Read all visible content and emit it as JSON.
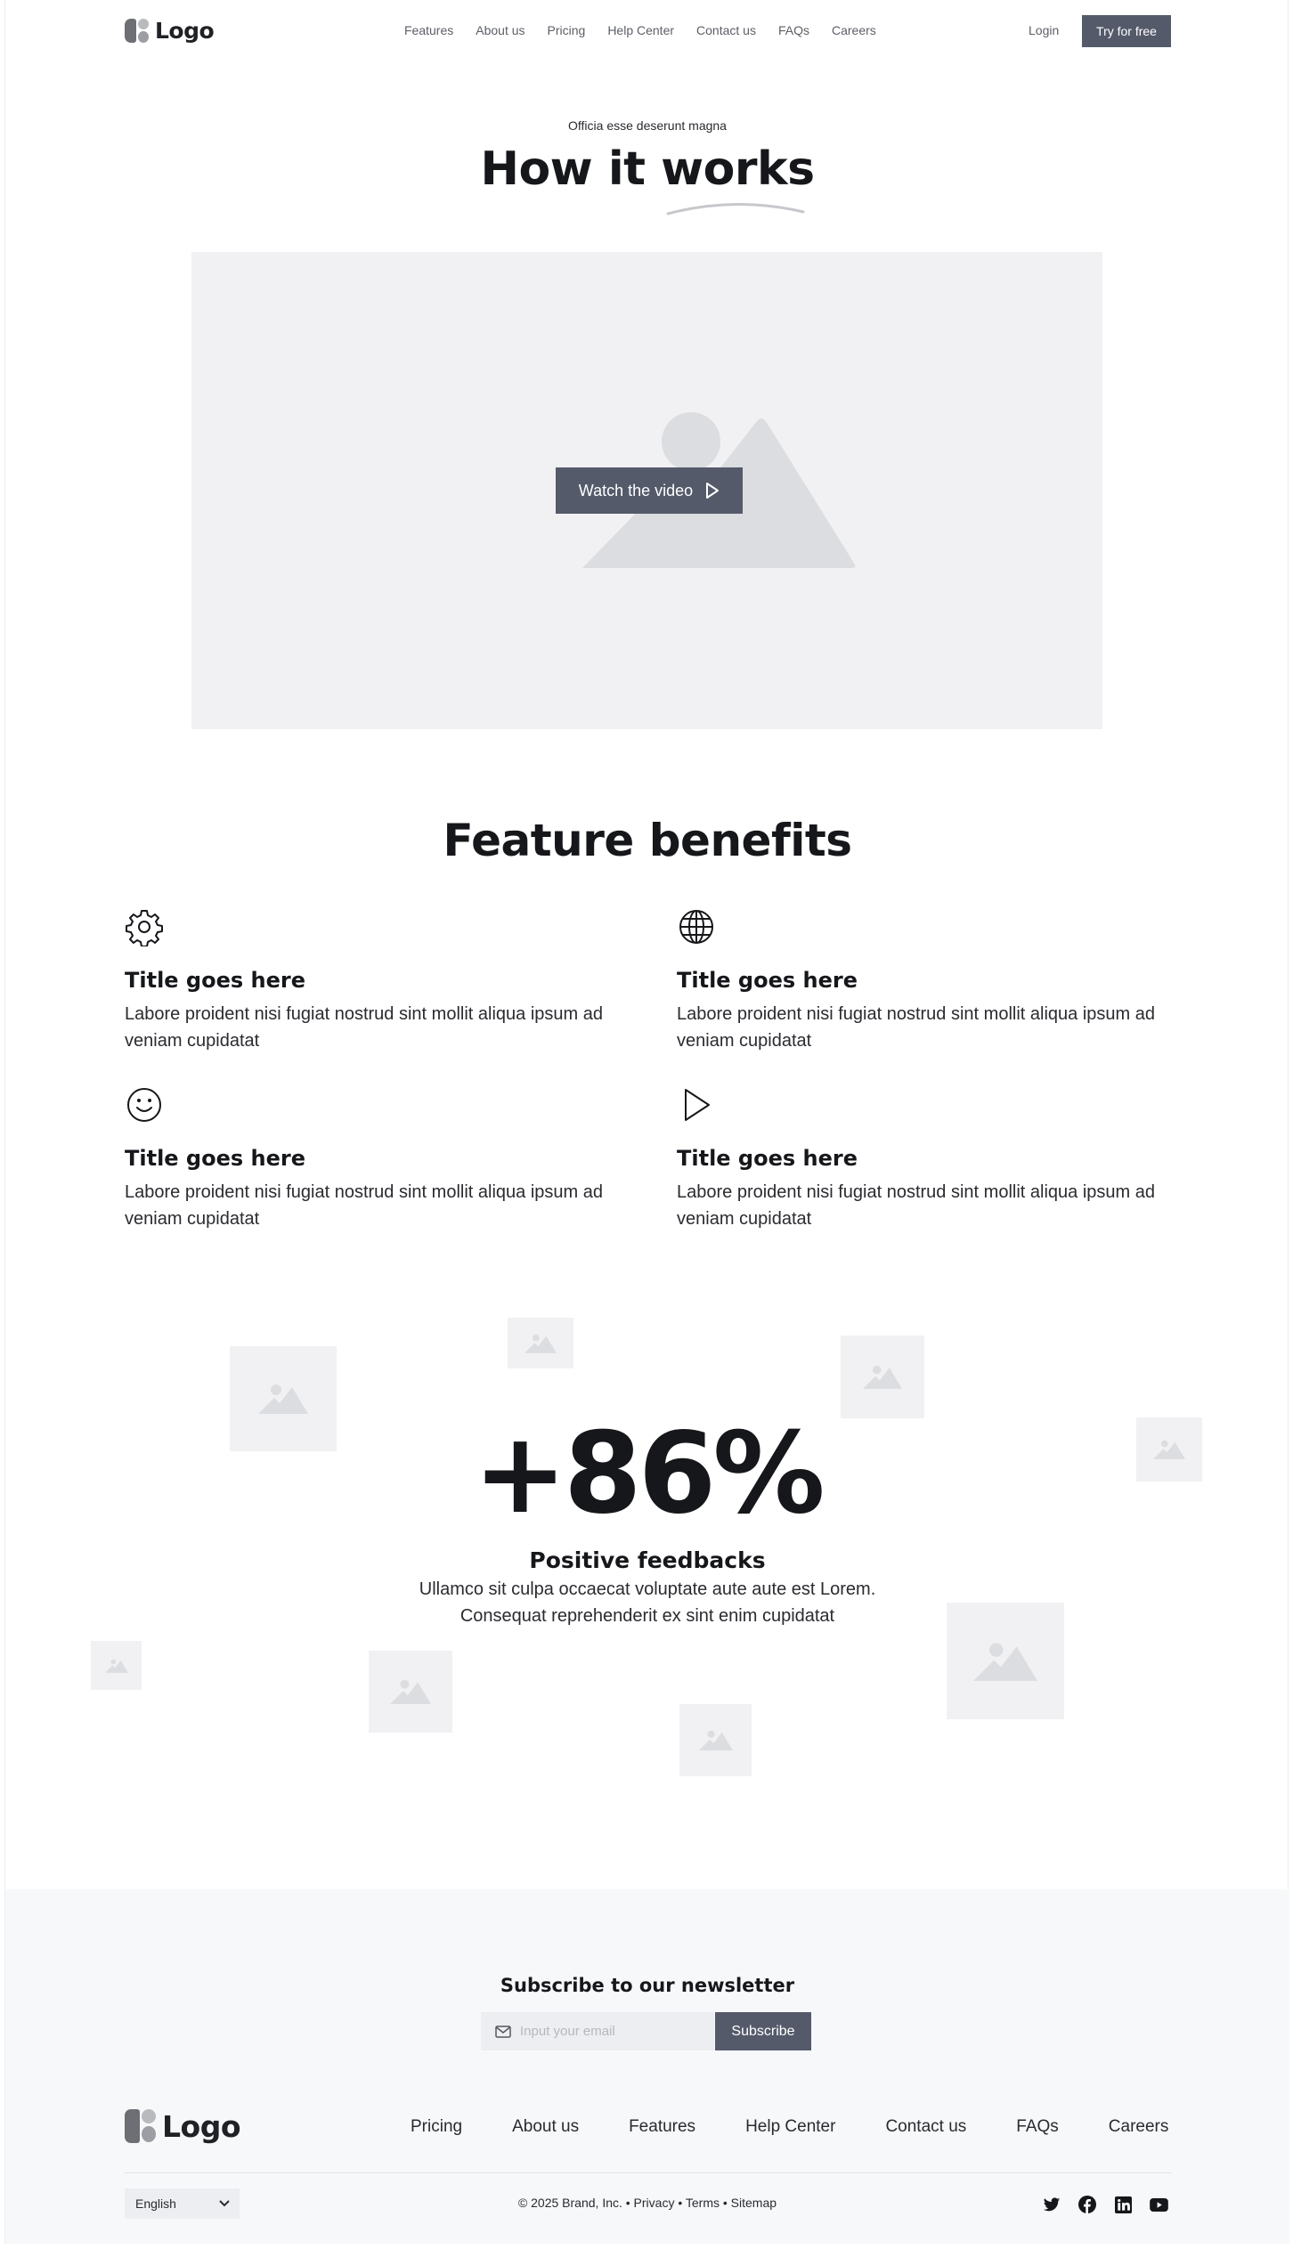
{
  "brand": {
    "logo_text": "Logo"
  },
  "nav": {
    "links": [
      "Features",
      "About us",
      "Pricing",
      "Help Center",
      "Contact us",
      "FAQs",
      "Careers"
    ],
    "login": "Login",
    "cta": "Try for free"
  },
  "hero": {
    "eyebrow": "Officia esse deserunt magna",
    "title": "How it works",
    "video_button": "Watch the video"
  },
  "features": {
    "heading": "Feature benefits",
    "items": [
      {
        "icon": "gear-icon",
        "title": "Title goes here",
        "text": "Labore proident nisi fugiat nostrud sint mollit aliqua ipsum ad veniam cupidatat"
      },
      {
        "icon": "globe-icon",
        "title": "Title goes here",
        "text": "Labore proident nisi fugiat nostrud sint mollit aliqua ipsum ad veniam cupidatat"
      },
      {
        "icon": "smiley-icon",
        "title": "Title goes here",
        "text": "Labore proident nisi fugiat nostrud sint mollit aliqua ipsum ad veniam cupidatat"
      },
      {
        "icon": "play-icon",
        "title": "Title goes here",
        "text": "Labore proident nisi fugiat nostrud sint mollit aliqua ipsum ad veniam cupidatat"
      }
    ]
  },
  "stats": {
    "value": "+86%",
    "label": "Positive feedbacks",
    "description": "Ullamco sit culpa occaecat voluptate aute aute est Lorem. Consequat reprehenderit ex sint enim cupidatat"
  },
  "newsletter": {
    "title": "Subscribe to our newsletter",
    "placeholder": "Input your email",
    "button": "Subscribe"
  },
  "footer": {
    "links": [
      "Pricing",
      "About us",
      "Features",
      "Help Center",
      "Contact us",
      "FAQs",
      "Careers"
    ],
    "language": "English",
    "copyright": "© 2025 Brand, Inc. • Privacy • Terms • Sitemap",
    "socials": [
      "twitter-icon",
      "facebook-icon",
      "linkedin-icon",
      "youtube-icon"
    ]
  },
  "colors": {
    "accent": "#545a6a",
    "text": "#16171b",
    "placeholder_bg": "#f1f1f3",
    "footer_bg": "#f7f8fa"
  }
}
